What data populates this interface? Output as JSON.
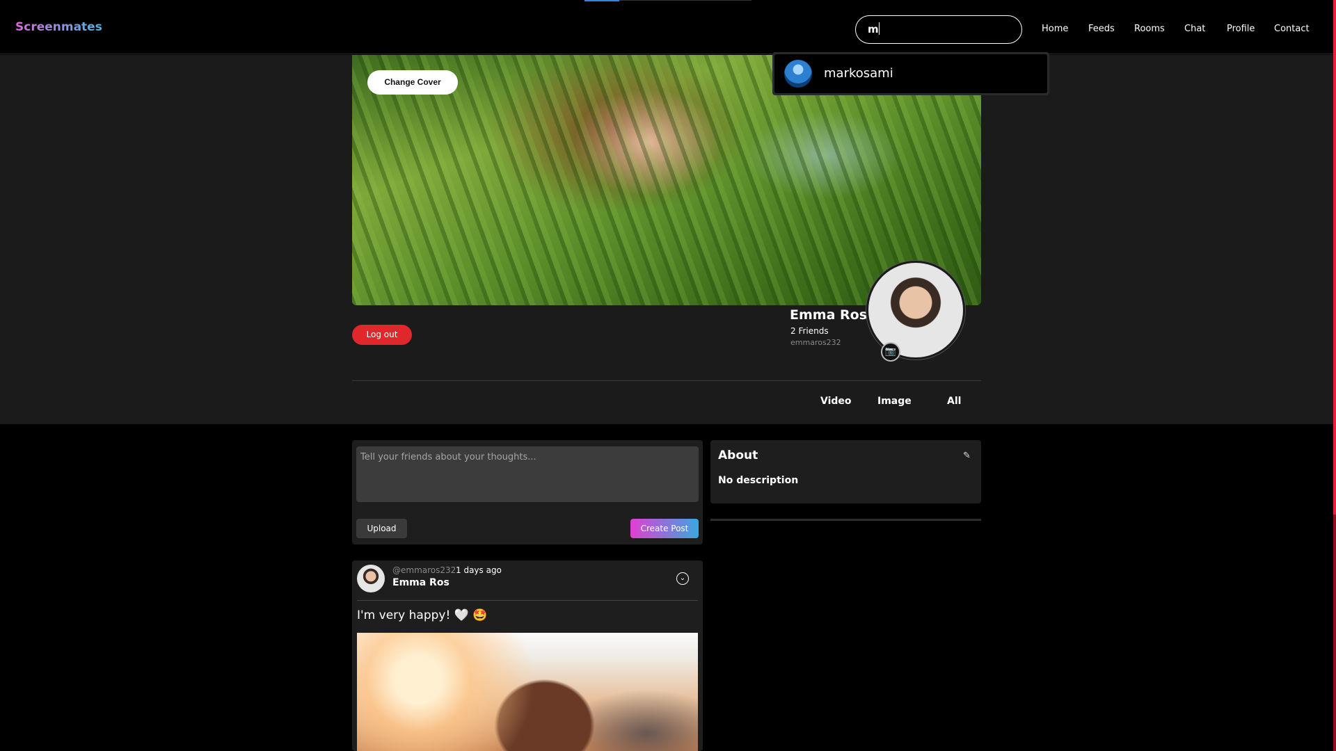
{
  "app": {
    "brand": "Screenmates"
  },
  "search": {
    "value": "m",
    "results": [
      {
        "username": "markosami"
      }
    ]
  },
  "nav": {
    "items": [
      "Home",
      "Feeds",
      "Rooms",
      "Chat",
      "Profile",
      "Contact"
    ]
  },
  "profile": {
    "change_cover_label": "Change Cover",
    "logout_label": "Log out",
    "name": "Emma Ros",
    "friends": "2 Friends",
    "handle": "emmaros232",
    "tabs": [
      "Video",
      "Image",
      "All"
    ]
  },
  "composer": {
    "placeholder": "Tell your friends about your thoughts...",
    "upload_label": "Upload",
    "create_label": "Create Post"
  },
  "about": {
    "title": "About",
    "description": "No description"
  },
  "post": {
    "handle": "@emmaros232",
    "time": "1 days ago",
    "author": "Emma Ros",
    "text": "I'm very happy! 🤍 🤩"
  },
  "colors": {
    "logout": "#e0282c",
    "brand_gradient_start": "#d96bd9",
    "brand_gradient_end": "#4fb3e0",
    "scrollbar": "#e6213f"
  }
}
